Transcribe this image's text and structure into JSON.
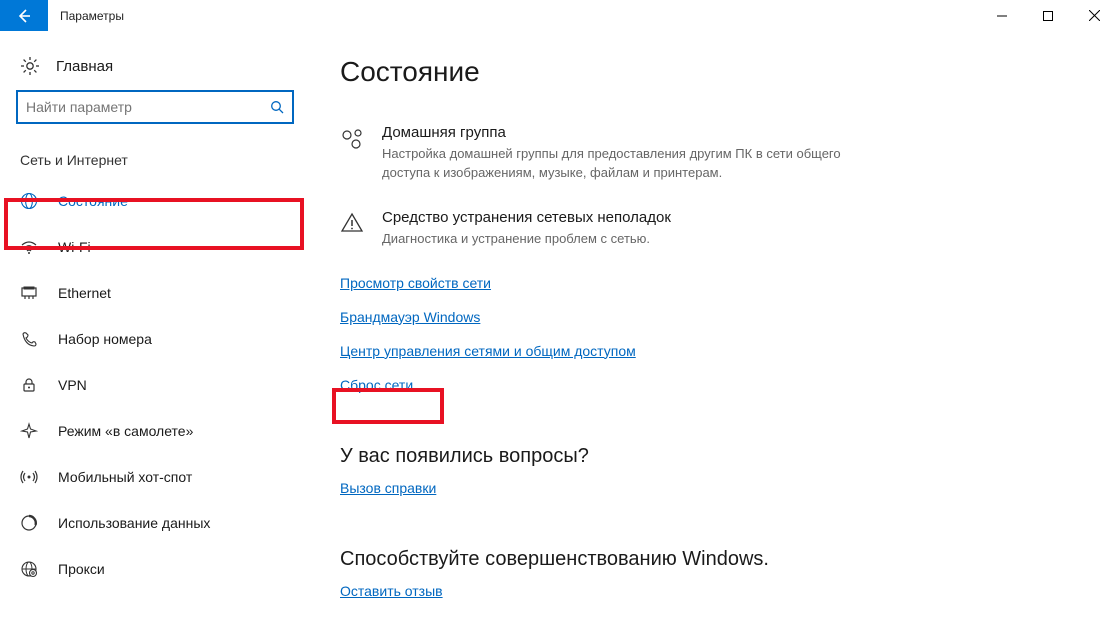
{
  "window": {
    "title": "Параметры"
  },
  "sidebar": {
    "home": "Главная",
    "search_placeholder": "Найти параметр",
    "category": "Сеть и Интернет",
    "items": [
      {
        "icon": "globe-icon",
        "label": "Состояние",
        "selected": true
      },
      {
        "icon": "wifi-icon",
        "label": "Wi-Fi"
      },
      {
        "icon": "ethernet-icon",
        "label": "Ethernet"
      },
      {
        "icon": "dialup-icon",
        "label": "Набор номера"
      },
      {
        "icon": "vpn-icon",
        "label": "VPN"
      },
      {
        "icon": "airplane-icon",
        "label": "Режим «в самолете»"
      },
      {
        "icon": "hotspot-icon",
        "label": "Мобильный хот-спот"
      },
      {
        "icon": "data-usage-icon",
        "label": "Использование данных"
      },
      {
        "icon": "proxy-icon",
        "label": "Прокси"
      }
    ]
  },
  "main": {
    "title": "Состояние",
    "homegroup": {
      "title": "Домашняя группа",
      "desc": "Настройка домашней группы для предоставления другим ПК в сети общего доступа к изображениям, музыке, файлам и принтерам."
    },
    "troubleshoot": {
      "title": "Средство устранения сетевых неполадок",
      "desc": "Диагностика и устранение проблем с сетью."
    },
    "links": {
      "view_props": "Просмотр свойств сети",
      "firewall": "Брандмауэр Windows",
      "sharing_center": "Центр управления сетями и общим доступом",
      "network_reset": "Сброс сети"
    },
    "questions": {
      "heading": "У вас появились вопросы?",
      "help": "Вызов справки"
    },
    "improve": {
      "heading": "Способствуйте совершенствованию Windows.",
      "feedback": "Оставить отзыв"
    }
  }
}
